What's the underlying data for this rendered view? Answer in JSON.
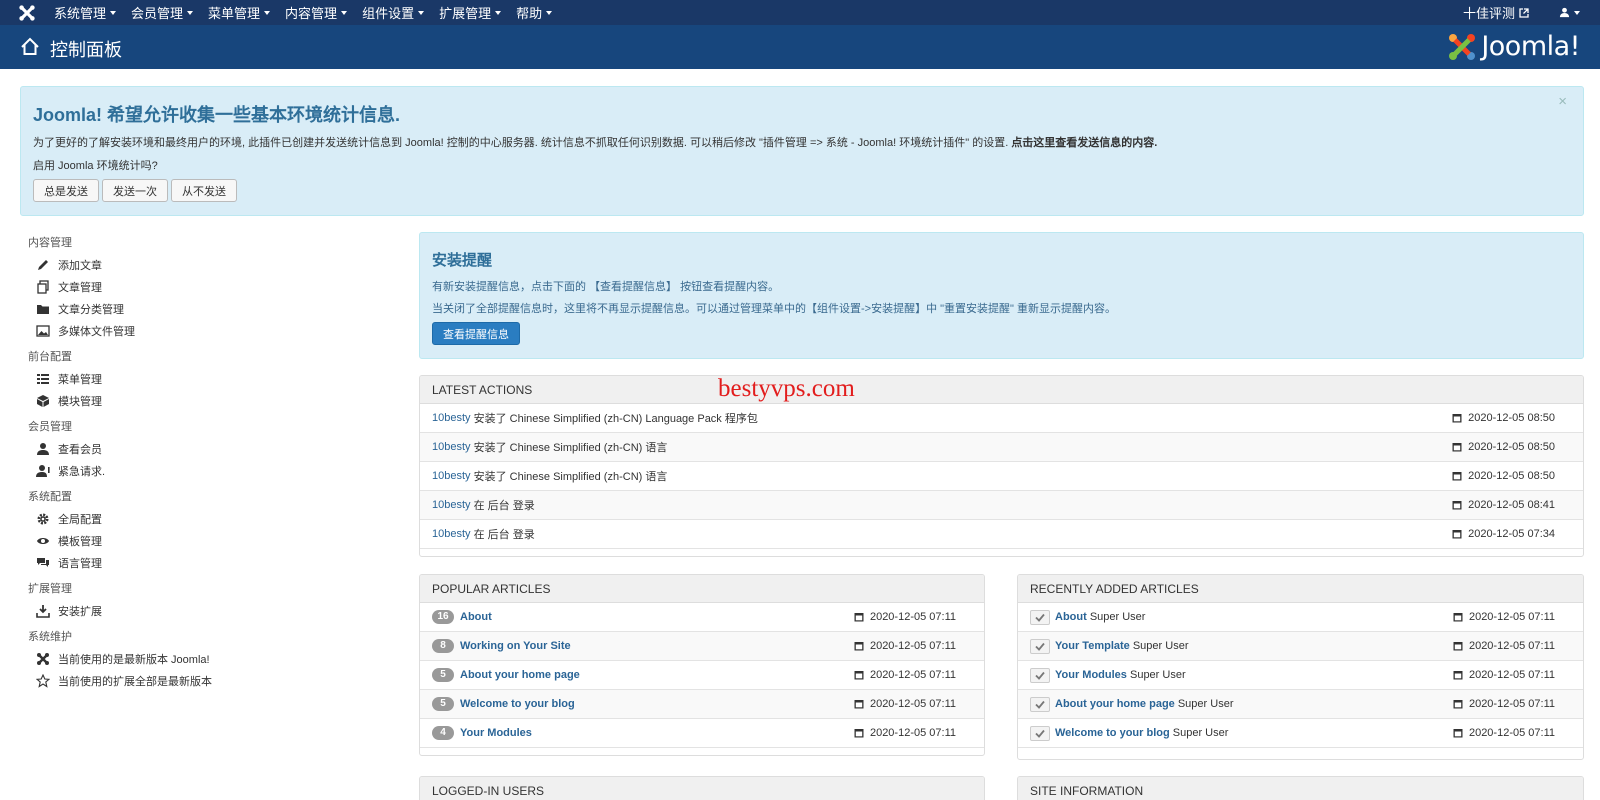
{
  "topnav": {
    "menu": [
      "系统管理",
      "会员管理",
      "菜单管理",
      "内容管理",
      "组件设置",
      "扩展管理",
      "帮助"
    ],
    "site_link": "十佳评测"
  },
  "header": {
    "title": "控制面板",
    "brand": "Joomla!"
  },
  "stats_alert": {
    "title": "Joomla! 希望允许收集一些基本环境统计信息.",
    "text": "为了更好的了解安装环境和最终用户的环境, 此插件已创建并发送统计信息到 Joomla! 控制的中心服务器. 统计信息不抓取任何识别数据. 可以稍后修改 \"插件管理 => 系统 - Joomla!  环境统计插件\" 的设置.",
    "link": "点击这里查看发送信息的内容.",
    "question": "启用 Joomla 环境统计吗?",
    "buttons": [
      "总是发送",
      "发送一次",
      "从不发送"
    ],
    "close": "×"
  },
  "sidebar": {
    "sections": [
      {
        "title": "内容管理",
        "items": [
          {
            "icon": "pencil-icon",
            "label": "添加文章"
          },
          {
            "icon": "copy-icon",
            "label": "文章管理"
          },
          {
            "icon": "folder-icon",
            "label": "文章分类管理"
          },
          {
            "icon": "image-icon",
            "label": "多媒体文件管理"
          }
        ]
      },
      {
        "title": "前台配置",
        "items": [
          {
            "icon": "list-icon",
            "label": "菜单管理"
          },
          {
            "icon": "cube-icon",
            "label": "模块管理"
          }
        ]
      },
      {
        "title": "会员管理",
        "items": [
          {
            "icon": "user-icon",
            "label": "查看会员"
          },
          {
            "icon": "user-alert-icon",
            "label": "紧急请求."
          }
        ]
      },
      {
        "title": "系统配置",
        "items": [
          {
            "icon": "cog-icon",
            "label": "全局配置"
          },
          {
            "icon": "eye-icon",
            "label": "模板管理"
          },
          {
            "icon": "comments-icon",
            "label": "语言管理"
          }
        ]
      },
      {
        "title": "扩展管理",
        "items": [
          {
            "icon": "download-icon",
            "label": "安装扩展"
          }
        ]
      },
      {
        "title": "系统维护",
        "items": [
          {
            "icon": "joomla-icon",
            "label": "当前使用的是最新版本 Joomla!"
          },
          {
            "icon": "star-icon",
            "label": "当前使用的扩展全部是最新版本"
          }
        ]
      }
    ]
  },
  "install_alert": {
    "title": "安装提醒",
    "line1": "有新安装提醒信息，点击下面的 【查看提醒信息】 按钮查看提醒内容。",
    "line2": "当关闭了全部提醒信息时，这里将不再显示提醒信息。可以通过管理菜单中的【组件设置->安装提醒】中 \"重置安装提醒\" 重新显示提醒内容。",
    "button": "查看提醒信息"
  },
  "latest_actions": {
    "title": "LATEST ACTIONS",
    "rows": [
      {
        "user": "10besty",
        "text": "安装了 Chinese Simplified (zh-CN) Language Pack 程序包",
        "date": "2020-12-05 08:50"
      },
      {
        "user": "10besty",
        "text": "安装了 Chinese Simplified (zh-CN) 语言",
        "date": "2020-12-05 08:50"
      },
      {
        "user": "10besty",
        "text": "安装了 Chinese Simplified (zh-CN) 语言",
        "date": "2020-12-05 08:50"
      },
      {
        "user": "10besty",
        "text": "在 后台 登录",
        "date": "2020-12-05 08:41"
      },
      {
        "user": "10besty",
        "text": "在 后台 登录",
        "date": "2020-12-05 07:34"
      }
    ]
  },
  "popular_articles": {
    "title": "POPULAR ARTICLES",
    "rows": [
      {
        "hits": "16",
        "title": "About",
        "date": "2020-12-05 07:11"
      },
      {
        "hits": "8",
        "title": "Working on Your Site",
        "date": "2020-12-05 07:11"
      },
      {
        "hits": "5",
        "title": "About your home page",
        "date": "2020-12-05 07:11"
      },
      {
        "hits": "5",
        "title": "Welcome to your blog",
        "date": "2020-12-05 07:11"
      },
      {
        "hits": "4",
        "title": "Your Modules",
        "date": "2020-12-05 07:11"
      }
    ]
  },
  "recent_articles": {
    "title": "RECENTLY ADDED ARTICLES",
    "rows": [
      {
        "title": "About",
        "author": "Super User",
        "date": "2020-12-05 07:11"
      },
      {
        "title": "Your Template",
        "author": "Super User",
        "date": "2020-12-05 07:11"
      },
      {
        "title": "Your Modules",
        "author": "Super User",
        "date": "2020-12-05 07:11"
      },
      {
        "title": "About your home page",
        "author": "Super User",
        "date": "2020-12-05 07:11"
      },
      {
        "title": "Welcome to your blog",
        "author": "Super User",
        "date": "2020-12-05 07:11"
      }
    ]
  },
  "logged_in_users": {
    "title": "LOGGED-IN USERS"
  },
  "site_information": {
    "title": "SITE INFORMATION"
  },
  "watermark": "bestyvps.com",
  "colors": {
    "topnav": "#1a3867",
    "header": "#17467d",
    "alert_bg": "#d9edf7",
    "link": "#2a6496",
    "primary_button": "#2a7dc1"
  }
}
